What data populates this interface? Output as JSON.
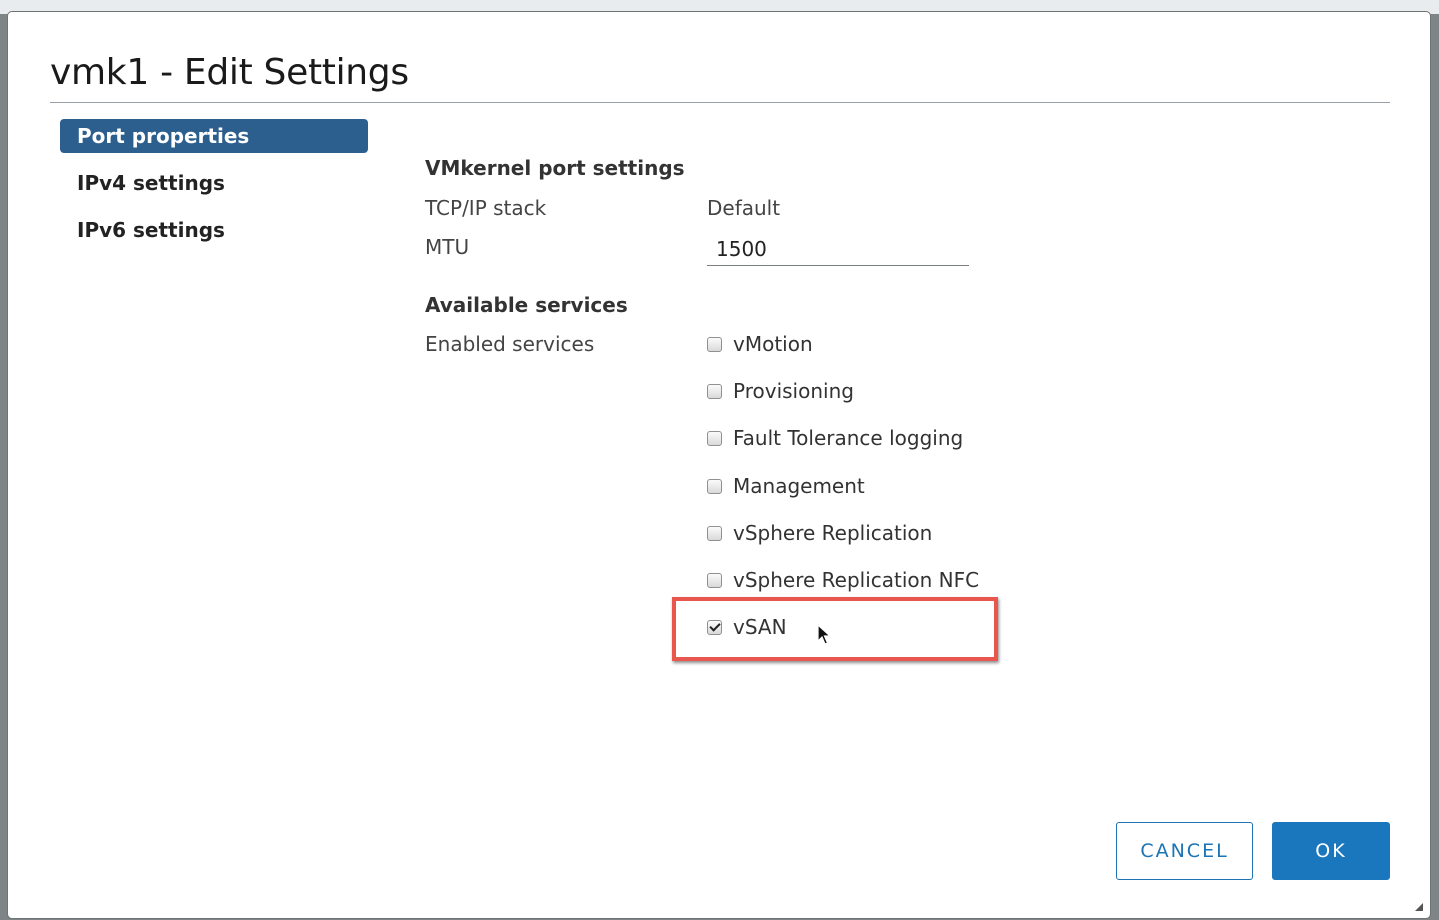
{
  "dialog": {
    "title": "vmk1 - Edit Settings"
  },
  "nav": {
    "items": [
      {
        "label": "Port properties",
        "active": true
      },
      {
        "label": "IPv4 settings",
        "active": false
      },
      {
        "label": "IPv6 settings",
        "active": false
      }
    ]
  },
  "port_settings": {
    "heading": "VMkernel port settings",
    "tcpip_label": "TCP/IP stack",
    "tcpip_value": "Default",
    "mtu_label": "MTU",
    "mtu_value": "1500"
  },
  "services": {
    "heading": "Available services",
    "enabled_label": "Enabled services",
    "items": [
      {
        "label": "vMotion",
        "checked": false
      },
      {
        "label": "Provisioning",
        "checked": false
      },
      {
        "label": "Fault Tolerance logging",
        "checked": false
      },
      {
        "label": "Management",
        "checked": false
      },
      {
        "label": "vSphere Replication",
        "checked": false
      },
      {
        "label": "vSphere Replication NFC",
        "checked": false
      },
      {
        "label": "vSAN",
        "checked": true
      }
    ]
  },
  "footer": {
    "cancel_label": "CANCEL",
    "ok_label": "OK"
  },
  "colors": {
    "accent": "#2d5f8e",
    "primary_button": "#1b77bd",
    "highlight": "#e9564d"
  }
}
